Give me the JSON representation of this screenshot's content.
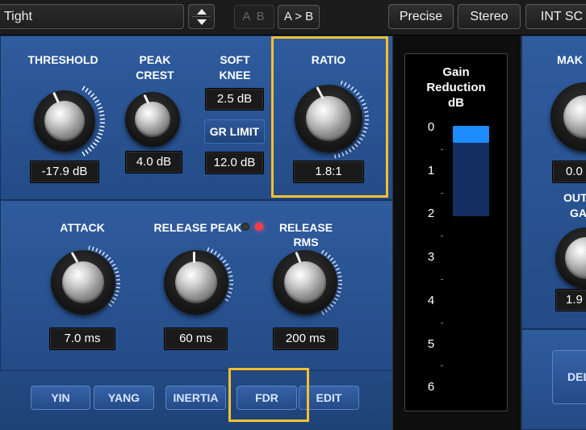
{
  "topbar": {
    "preset": "Tight",
    "ab": "A B",
    "ab_copy": "A > B",
    "precise": "Precise",
    "stereo": "Stereo",
    "int_sc": "INT SC"
  },
  "section1": {
    "threshold": {
      "label": "THRESHOLD",
      "value": "-17.9 dB"
    },
    "peak_crest": {
      "label_line1": "PEAK",
      "label_line2": "CREST",
      "value": "4.0 dB"
    },
    "soft_knee": {
      "label_line1": "SOFT",
      "label_line2": "KNEE",
      "value": "2.5 dB"
    },
    "gr_limit": "GR LIMIT",
    "gr_limit_value": "12.0 dB",
    "ratio": {
      "label": "RATIO",
      "value": "1.8:1"
    }
  },
  "section2": {
    "attack": {
      "label": "ATTACK",
      "value": "7.0 ms"
    },
    "release_peak": {
      "label": "RELEASE PEAK",
      "value": "60 ms"
    },
    "release_rms": {
      "label": "RELEASE RMS",
      "value": "200 ms"
    }
  },
  "modes": {
    "yin": "YIN",
    "yang": "YANG",
    "inertia": "INERTIA",
    "fdr": "FDR",
    "edit": "EDIT"
  },
  "meter": {
    "title_line1": "Gain",
    "title_line2": "Reduction",
    "title_line3": "dB",
    "scale": [
      "0",
      "1",
      "2",
      "3",
      "4",
      "5",
      "6"
    ],
    "gain_reduction_db": 0.4
  },
  "right_panel": {
    "makeup_label": "MAK",
    "makeup_value": "0.0",
    "output_label_line1": "OUT",
    "output_label_line2": "GA",
    "output_value": "1.9",
    "delta_button": "DEL"
  },
  "colors": {
    "panel_blue": "#2f5c9e",
    "highlight": "#f4c030",
    "meter_fill": "#1e8bff",
    "led_on": "#ff3b4a"
  },
  "icons": {
    "stepper_up": "triangle-up-icon",
    "stepper_down": "triangle-down-icon"
  }
}
